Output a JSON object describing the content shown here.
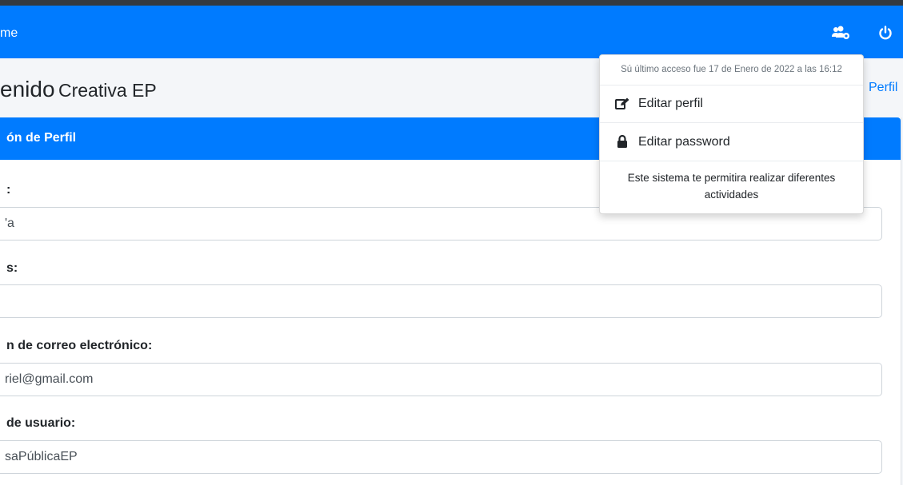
{
  "navbar": {
    "brand_partial": "me",
    "users_icon": "users-cog-icon",
    "power_icon": "power-off-icon",
    "color": "#007bff"
  },
  "header": {
    "welcome_partial": "enido",
    "user_name": "Creativa EP",
    "breadcrumb_partial": "Perfil"
  },
  "card": {
    "title_partial": "ón de Perfil",
    "fields": [
      {
        "label": ":",
        "value": "'a"
      },
      {
        "label": "s:",
        "value": ""
      },
      {
        "label": "n de correo electrónico:",
        "value": "riel@gmail.com"
      },
      {
        "label": " de usuario:",
        "value": "saPúblicaEP"
      }
    ]
  },
  "dropdown": {
    "last_access": "Sú último acceso fue 17 de Enero de 2022 a las 16:12",
    "items": [
      {
        "label": "Editar perfil",
        "icon": "edit-icon"
      },
      {
        "label": "Editar password",
        "icon": "lock-icon"
      }
    ],
    "footer": "Este sistema te permitira realizar diferentes actividades"
  }
}
